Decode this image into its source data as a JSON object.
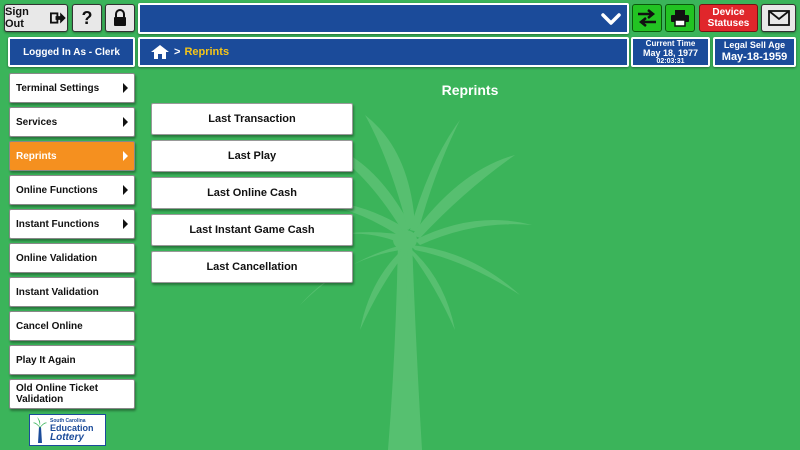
{
  "header": {
    "sign_out_label": "Sign Out",
    "help_label": "?",
    "device_statuses_line1": "Device",
    "device_statuses_line2": "Statuses",
    "logged_in_label": "Logged In As - Clerk",
    "breadcrumb_label": "Reprints",
    "current_time_label": "Current Time",
    "current_date": "May 18, 1977",
    "current_time": "02:03:31",
    "legal_sell_age_label": "Legal Sell Age",
    "legal_sell_age_date": "May-18-1959"
  },
  "sidebar": {
    "items": [
      {
        "label": "Terminal Settings",
        "has_submenu": true
      },
      {
        "label": "Services",
        "has_submenu": true
      },
      {
        "label": "Reprints",
        "has_submenu": true,
        "active": true
      },
      {
        "label": "Online Functions",
        "has_submenu": true
      },
      {
        "label": "Instant Functions",
        "has_submenu": true
      },
      {
        "label": "Online Validation"
      },
      {
        "label": "Instant Validation"
      },
      {
        "label": "Cancel Online"
      },
      {
        "label": "Play It Again"
      },
      {
        "label": "Old Online Ticket Validation"
      }
    ]
  },
  "main": {
    "title": "Reprints",
    "buttons": [
      "Last Transaction",
      "Last Play",
      "Last Online Cash",
      "Last Instant Game Cash",
      "Last Cancellation"
    ]
  },
  "logo": {
    "line1": "South Carolina",
    "line2": "Education",
    "line3": "Lottery"
  },
  "colors": {
    "background": "#3bb45a",
    "header_blue": "#1b4b9a",
    "active_item": "#f5901f",
    "status_red": "#e0262b",
    "action_green": "#22c322"
  }
}
